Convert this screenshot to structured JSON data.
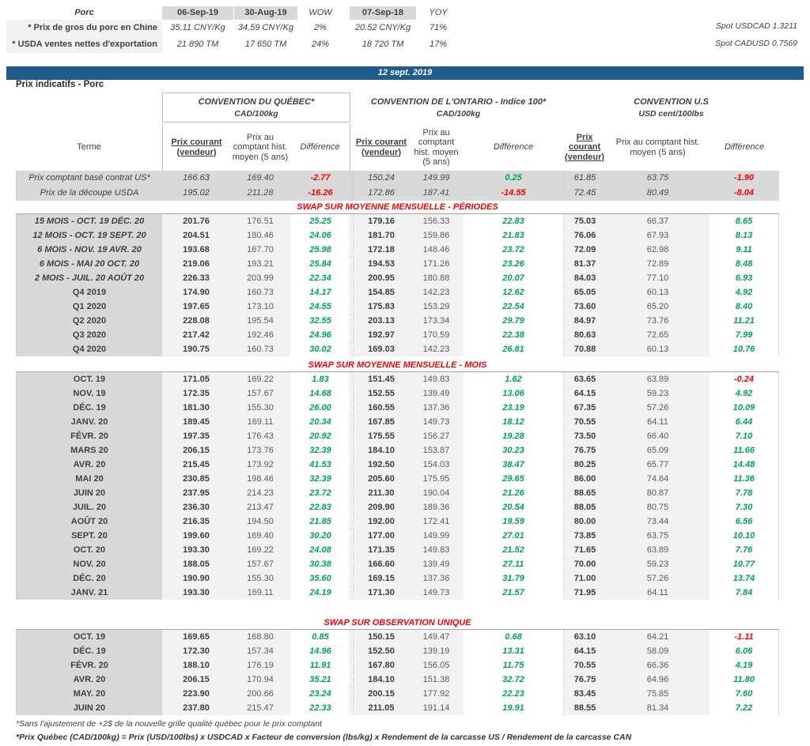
{
  "header_table": {
    "title": "Porc",
    "columns": [
      "06-Sep-19",
      "30-Aug-19",
      "WOW",
      "07-Sep-18",
      "YOY"
    ],
    "rows": [
      {
        "label": "* Prix de gros du porc en Chine",
        "values": [
          "35.11 CNY/Kg",
          "34.59 CNY/Kg",
          "2%",
          "20.52 CNY/Kg",
          "71%"
        ]
      },
      {
        "label": "* USDA ventes nettes d'exportation",
        "values": [
          "21 890  TM",
          "17 650  TM",
          "24%",
          "18 720  TM",
          "17%"
        ]
      }
    ],
    "spot_rates": [
      "Spot USDCAD 1.3211",
      "Spot CADUSD 0.7569"
    ]
  },
  "date_banner": "12 sept. 2019",
  "page_title": "Prix indicatifs - Porc",
  "groups": [
    {
      "title": "CONVENTION DU QUÉBEC*",
      "unit": "CAD/100kg"
    },
    {
      "title": "CONVENTION DE L'ONTARIO - Indice 100*",
      "unit": "CAD/100kg"
    },
    {
      "title": "CONVENTION U.S",
      "unit": "USD cent/100lbs"
    }
  ],
  "col_headers": {
    "terme": "Terme",
    "prix_courant": "Prix courant (vendeur)",
    "hist": "Prix au comptant hist. moyen (5 ans)",
    "difference": "Différence"
  },
  "spot_rows": [
    {
      "terme": "Prix comptant basé contrat US*",
      "q": [
        "166.63",
        "169.40",
        "-2.77"
      ],
      "o": [
        "150.24",
        "149.99",
        "0.25"
      ],
      "u": [
        "61.85",
        "63.75",
        "-1.90"
      ]
    },
    {
      "terme": "Prix de la découpe USDA",
      "q": [
        "195.02",
        "211.28",
        "-16.26"
      ],
      "o": [
        "172.86",
        "187.41",
        "-14.55"
      ],
      "u": [
        "72.45",
        "80.49",
        "-8.04"
      ]
    }
  ],
  "sections": [
    {
      "title": "SWAP SUR MOYENNE MENSUELLE - PÉRIODES",
      "rows": [
        {
          "terme": "15 MOIS -  OCT. 19 DÉC. 20",
          "q": [
            "201.76",
            "176.51",
            "25.25"
          ],
          "o": [
            "179.16",
            "156.33",
            "22.83"
          ],
          "u": [
            "75.03",
            "66.37",
            "8.65"
          ]
        },
        {
          "terme": "12 MOIS -  OCT. 19 SEPT. 20",
          "q": [
            "204.51",
            "180.46",
            "24.06"
          ],
          "o": [
            "181.70",
            "159.86",
            "21.83"
          ],
          "u": [
            "76.06",
            "67.93",
            "8.13"
          ]
        },
        {
          "terme": "6 MOIS -  NOV. 19 AVR. 20",
          "q": [
            "193.68",
            "167.70",
            "25.98"
          ],
          "o": [
            "172.18",
            "148.46",
            "23.72"
          ],
          "u": [
            "72.09",
            "62.98",
            "9.11"
          ]
        },
        {
          "terme": "6 MOIS -  MAI 20 OCT. 20",
          "q": [
            "219.06",
            "193.21",
            "25.84"
          ],
          "o": [
            "194.53",
            "171.26",
            "23.26"
          ],
          "u": [
            "81.37",
            "72.89",
            "8.48"
          ]
        },
        {
          "terme": "2 MOIS -  JUIL. 20  AOÛT 20",
          "q": [
            "226.33",
            "203.99",
            "22.34"
          ],
          "o": [
            "200.95",
            "180.88",
            "20.07"
          ],
          "u": [
            "84.03",
            "77.10",
            "6.93"
          ]
        },
        {
          "terme": "Q4 2019",
          "q": [
            "174.90",
            "160.73",
            "14.17"
          ],
          "o": [
            "154.85",
            "142.23",
            "12.62"
          ],
          "u": [
            "65.05",
            "60.13",
            "4.92"
          ]
        },
        {
          "terme": "Q1 2020",
          "q": [
            "197.65",
            "173.10",
            "24.55"
          ],
          "o": [
            "175.83",
            "153.29",
            "22.54"
          ],
          "u": [
            "73.60",
            "65.20",
            "8.40"
          ]
        },
        {
          "terme": "Q2 2020",
          "q": [
            "228.08",
            "195.54",
            "32.55"
          ],
          "o": [
            "203.13",
            "173.34",
            "29.79"
          ],
          "u": [
            "84.97",
            "73.76",
            "11.21"
          ]
        },
        {
          "terme": "Q3 2020",
          "q": [
            "217.42",
            "192.46",
            "24.96"
          ],
          "o": [
            "192.97",
            "170.59",
            "22.38"
          ],
          "u": [
            "80.63",
            "72.65",
            "7.99"
          ]
        },
        {
          "terme": "Q4 2020",
          "q": [
            "190.75",
            "160.73",
            "30.02"
          ],
          "o": [
            "169.03",
            "142.23",
            "26.81"
          ],
          "u": [
            "70.88",
            "60.13",
            "10.76"
          ]
        }
      ]
    },
    {
      "title": "SWAP SUR MOYENNE MENSUELLE - MOIS",
      "rows": [
        {
          "terme": "OCT. 19",
          "q": [
            "171.05",
            "169.22",
            "1.83"
          ],
          "o": [
            "151.45",
            "149.83",
            "1.62"
          ],
          "u": [
            "63.65",
            "63.89",
            "-0.24"
          ]
        },
        {
          "terme": "NOV. 19",
          "q": [
            "172.35",
            "157.67",
            "14.68"
          ],
          "o": [
            "152.55",
            "139.49",
            "13.06"
          ],
          "u": [
            "64.15",
            "59.23",
            "4.92"
          ]
        },
        {
          "terme": "DÉC. 19",
          "q": [
            "181.30",
            "155.30",
            "26.00"
          ],
          "o": [
            "160.55",
            "137.36",
            "23.19"
          ],
          "u": [
            "67.35",
            "57.26",
            "10.09"
          ]
        },
        {
          "terme": "JANV. 20",
          "q": [
            "189.45",
            "169.11",
            "20.34"
          ],
          "o": [
            "167.85",
            "149.73",
            "18.12"
          ],
          "u": [
            "70.55",
            "64.11",
            "6.44"
          ]
        },
        {
          "terme": "FÉVR. 20",
          "q": [
            "197.35",
            "176.43",
            "20.92"
          ],
          "o": [
            "175.55",
            "156.27",
            "19.28"
          ],
          "u": [
            "73.50",
            "66.40",
            "7.10"
          ]
        },
        {
          "terme": "MARS 20",
          "q": [
            "206.15",
            "173.76",
            "32.39"
          ],
          "o": [
            "184.10",
            "153.87",
            "30.23"
          ],
          "u": [
            "76.75",
            "65.09",
            "11.66"
          ]
        },
        {
          "terme": "AVR. 20",
          "q": [
            "215.45",
            "173.92",
            "41.53"
          ],
          "o": [
            "192.50",
            "154.03",
            "38.47"
          ],
          "u": [
            "80.25",
            "65.77",
            "14.48"
          ]
        },
        {
          "terme": "MAI 20",
          "q": [
            "230.85",
            "198.46",
            "32.39"
          ],
          "o": [
            "205.60",
            "175.95",
            "29.65"
          ],
          "u": [
            "86.00",
            "74.64",
            "11.36"
          ]
        },
        {
          "terme": "JUIN 20",
          "q": [
            "237.95",
            "214.23",
            "23.72"
          ],
          "o": [
            "211.30",
            "190.04",
            "21.26"
          ],
          "u": [
            "88.65",
            "80.87",
            "7.78"
          ]
        },
        {
          "terme": "JUIL. 20",
          "q": [
            "236.30",
            "213.47",
            "22.83"
          ],
          "o": [
            "209.90",
            "189.36",
            "20.54"
          ],
          "u": [
            "88.05",
            "80.75",
            "7.30"
          ]
        },
        {
          "terme": "AOÛT 20",
          "q": [
            "216.35",
            "194.50",
            "21.85"
          ],
          "o": [
            "192.00",
            "172.41",
            "19.59"
          ],
          "u": [
            "80.00",
            "73.44",
            "6.56"
          ]
        },
        {
          "terme": "SEPT. 20",
          "q": [
            "199.60",
            "169.40",
            "30.20"
          ],
          "o": [
            "177.00",
            "149.99",
            "27.01"
          ],
          "u": [
            "73.85",
            "63.75",
            "10.10"
          ]
        },
        {
          "terme": "OCT. 20",
          "q": [
            "193.30",
            "169.22",
            "24.08"
          ],
          "o": [
            "171.35",
            "149.83",
            "21.52"
          ],
          "u": [
            "71.65",
            "63.89",
            "7.76"
          ]
        },
        {
          "terme": "NOV. 20",
          "q": [
            "188.05",
            "157.67",
            "30.38"
          ],
          "o": [
            "166.60",
            "139.49",
            "27.11"
          ],
          "u": [
            "70.00",
            "59.23",
            "10.77"
          ]
        },
        {
          "terme": "DÉC. 20",
          "q": [
            "190.90",
            "155.30",
            "35.60"
          ],
          "o": [
            "169.15",
            "137.36",
            "31.79"
          ],
          "u": [
            "71.00",
            "57.26",
            "13.74"
          ]
        },
        {
          "terme": "JANV. 21",
          "q": [
            "193.30",
            "169.11",
            "24.19"
          ],
          "o": [
            "171.30",
            "149.73",
            "21.57"
          ],
          "u": [
            "71.95",
            "64.11",
            "7.84"
          ]
        }
      ]
    },
    {
      "title": "SWAP SUR OBSERVATION UNIQUE",
      "rows": [
        {
          "terme": "OCT. 19",
          "q": [
            "169.65",
            "168.80",
            "0.85"
          ],
          "o": [
            "150.15",
            "149.47",
            "0.68"
          ],
          "u": [
            "63.10",
            "64.21",
            "-1.11"
          ]
        },
        {
          "terme": "DÉC. 19",
          "q": [
            "172.30",
            "157.34",
            "14.96"
          ],
          "o": [
            "152.50",
            "139.19",
            "13.31"
          ],
          "u": [
            "64.15",
            "58.09",
            "6.06"
          ]
        },
        {
          "terme": "FÉVR. 20",
          "q": [
            "188.10",
            "176.19",
            "11.91"
          ],
          "o": [
            "167.80",
            "156.05",
            "11.75"
          ],
          "u": [
            "70.55",
            "66.36",
            "4.19"
          ]
        },
        {
          "terme": "AVR. 20",
          "q": [
            "206.15",
            "170.94",
            "35.21"
          ],
          "o": [
            "184.10",
            "151.38",
            "32.72"
          ],
          "u": [
            "76.75",
            "64.96",
            "11.80"
          ]
        },
        {
          "terme": "MAY. 20",
          "q": [
            "223.90",
            "200.66",
            "23.24"
          ],
          "o": [
            "200.15",
            "177.92",
            "22.23"
          ],
          "u": [
            "83.45",
            "75.85",
            "7.60"
          ]
        },
        {
          "terme": "JUIN 20",
          "q": [
            "237.80",
            "215.47",
            "22.33"
          ],
          "o": [
            "211.05",
            "191.14",
            "19.91"
          ],
          "u": [
            "88.55",
            "81.34",
            "7.22"
          ]
        }
      ]
    }
  ],
  "footnotes": [
    "*Sans l'ajustement de +2$ de la nouvelle grille qualité québec pour le prix comptant",
    "*Prix Québec (CAD/100kg) = Prix (USD/100lbs) x USDCAD x Facteur de conversion (lbs/kg) x Rendement de la carcasse US / Rendement de la carcasse CAN"
  ],
  "colors": {
    "banner_blue": "#1F5C8B",
    "positive_green": "#00A651",
    "negative_red": "#FF0000",
    "terme_gray": "#D9D9D9",
    "value_gray": "#F2F2F2",
    "section_red": "#FF0000"
  }
}
